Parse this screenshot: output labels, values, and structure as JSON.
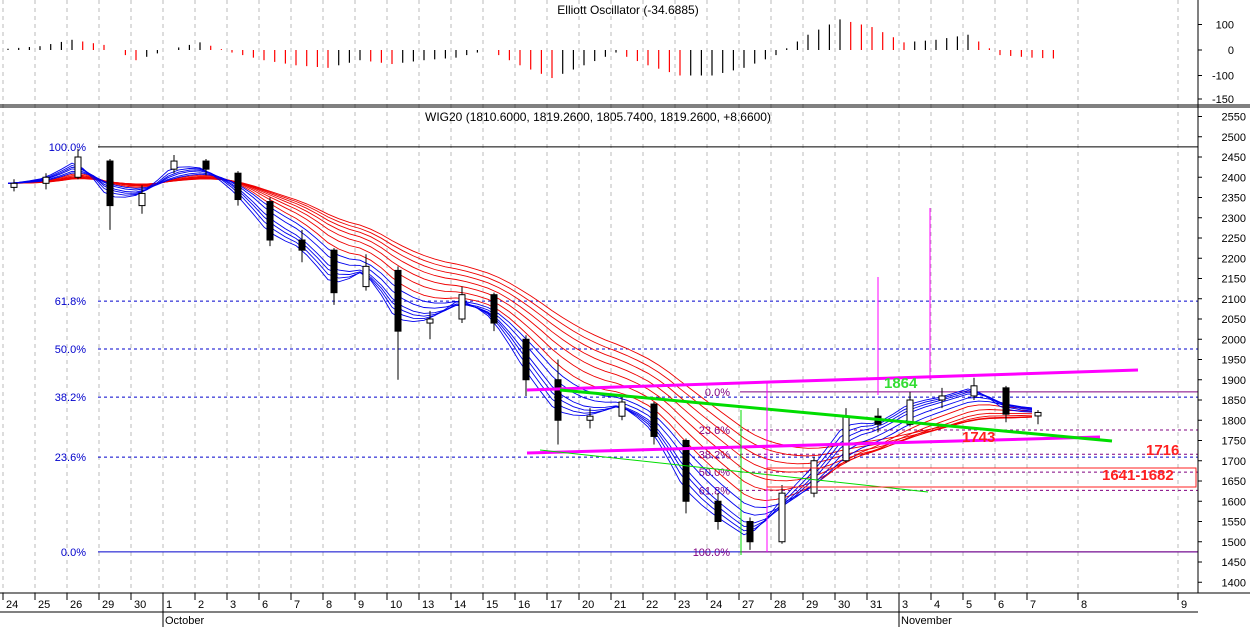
{
  "chart_data": {
    "type": "candlestick",
    "panels": [
      {
        "name": "oscillator",
        "title": "Elliott Oscillator (-34.6885)",
        "y_ticks": [
          100,
          0,
          -100,
          -150
        ],
        "ylim": [
          -170,
          170
        ],
        "values": [
          5,
          15,
          40,
          20,
          -40,
          0,
          30,
          -10,
          -40,
          -60,
          -70,
          -40,
          -55,
          -40,
          -30,
          0,
          -60,
          -110,
          -60,
          -10,
          -60,
          -100,
          -100,
          -70,
          -20,
          60,
          120,
          90,
          30,
          40,
          60,
          -20,
          -30,
          -35
        ]
      },
      {
        "name": "price",
        "title": "WIG20 (1810.6000, 1819.2600, 1805.7400, 1819.2600, +8.6600)",
        "y_ticks": [
          2550,
          2500,
          2450,
          2400,
          2350,
          2300,
          2250,
          2200,
          2150,
          2100,
          2050,
          2000,
          1950,
          1900,
          1850,
          1800,
          1750,
          1700,
          1650,
          1600,
          1550,
          1500,
          1450,
          1400
        ],
        "ylim": [
          1380,
          2560
        ],
        "ohlc": [
          [
            2375,
            2395,
            2365,
            2385
          ],
          [
            2385,
            2410,
            2370,
            2400
          ],
          [
            2400,
            2470,
            2395,
            2450
          ],
          [
            2440,
            2445,
            2270,
            2330
          ],
          [
            2330,
            2380,
            2310,
            2360
          ],
          [
            2420,
            2455,
            2410,
            2440
          ],
          [
            2440,
            2445,
            2405,
            2420
          ],
          [
            2410,
            2415,
            2330,
            2345
          ],
          [
            2340,
            2350,
            2230,
            2245
          ],
          [
            2245,
            2270,
            2190,
            2220
          ],
          [
            2220,
            2225,
            2085,
            2115
          ],
          [
            2130,
            2210,
            2120,
            2180
          ],
          [
            2170,
            2180,
            1900,
            2020
          ],
          [
            2040,
            2070,
            2000,
            2050
          ],
          [
            2050,
            2130,
            2040,
            2110
          ],
          [
            2110,
            2115,
            2020,
            2040
          ],
          [
            2000,
            2010,
            1860,
            1900
          ],
          [
            1900,
            1950,
            1740,
            1800
          ],
          [
            1800,
            1830,
            1780,
            1810
          ],
          [
            1810,
            1860,
            1800,
            1845
          ],
          [
            1840,
            1845,
            1740,
            1760
          ],
          [
            1750,
            1755,
            1570,
            1600
          ],
          [
            1600,
            1620,
            1530,
            1550
          ],
          [
            1550,
            1560,
            1480,
            1500
          ],
          [
            1500,
            1640,
            1495,
            1620
          ],
          [
            1620,
            1710,
            1610,
            1700
          ],
          [
            1700,
            1830,
            1695,
            1810
          ],
          [
            1810,
            1830,
            1770,
            1790
          ],
          [
            1790,
            1870,
            1785,
            1850
          ],
          [
            1850,
            1880,
            1830,
            1860
          ],
          [
            1860,
            1905,
            1850,
            1885
          ],
          [
            1880,
            1885,
            1795,
            1815
          ],
          [
            1810.6,
            1825,
            1790,
            1819.26
          ]
        ],
        "fib_left": [
          {
            "label": "100.0%",
            "value": 2475
          },
          {
            "label": "61.8%",
            "value": 2094
          },
          {
            "label": "50.0%",
            "value": 1976
          },
          {
            "label": "38.2%",
            "value": 1857
          },
          {
            "label": "23.6%",
            "value": 1709
          },
          {
            "label": "0.0%",
            "value": 1475
          }
        ],
        "fib_right": [
          {
            "label": "0.0%",
            "value": 1870
          },
          {
            "label": "23.6%",
            "value": 1776
          },
          {
            "label": "38.2%",
            "value": 1716
          },
          {
            "label": "50.0%",
            "value": 1672
          },
          {
            "label": "61.8%",
            "value": 1627
          },
          {
            "label": "100.0%",
            "value": 1475
          }
        ],
        "annotations": [
          {
            "text": "1864",
            "color": "#33dd33"
          },
          {
            "text": "1743",
            "color": "#ff2020"
          },
          {
            "text": "1716",
            "color": "#ff2020"
          },
          {
            "text": "1641-1682",
            "color": "#ff2020"
          }
        ]
      }
    ],
    "x_days": [
      "24",
      "25",
      "26",
      "29",
      "30",
      "1",
      "2",
      "3",
      "6",
      "7",
      "8",
      "9",
      "10",
      "13",
      "14",
      "15",
      "16",
      "17",
      "20",
      "21",
      "22",
      "23",
      "24",
      "27",
      "28",
      "29",
      "30",
      "31",
      "3",
      "4",
      "5",
      "6",
      "7",
      "8",
      "9"
    ],
    "months": [
      {
        "label": "October",
        "day_index": 5
      },
      {
        "label": "November",
        "day_index": 28
      }
    ],
    "colors": {
      "bull_ema": "#0000ee",
      "bear_ema": "#ee0000",
      "fib_left": "#0000cc",
      "fib_right": "#800080",
      "trend_magenta": "#ff00ff",
      "trend_green": "#00dd00",
      "osc": "#ff0000"
    }
  }
}
